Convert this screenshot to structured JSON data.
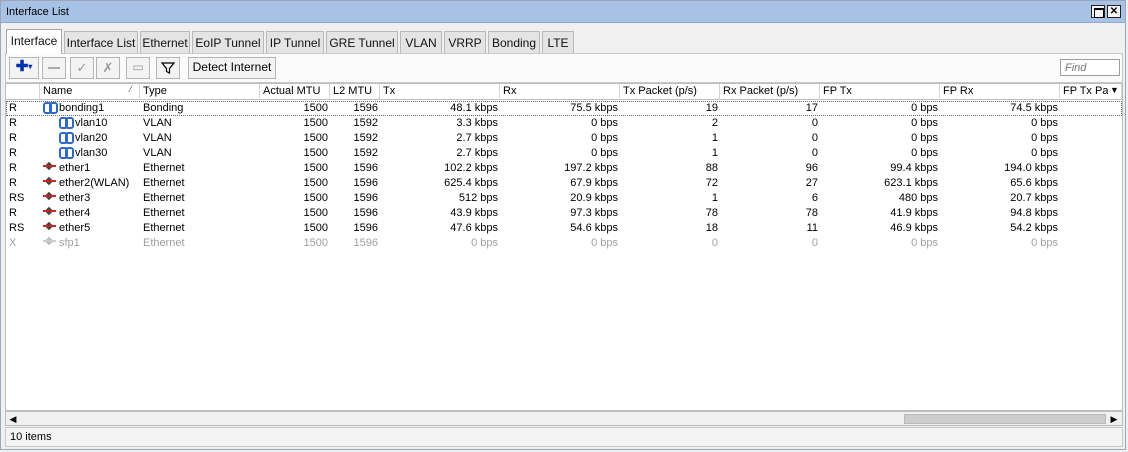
{
  "window": {
    "title": "Interface List"
  },
  "tabs": [
    {
      "label": "Interface",
      "active": true
    },
    {
      "label": "Interface List"
    },
    {
      "label": "Ethernet"
    },
    {
      "label": "EoIP Tunnel"
    },
    {
      "label": "IP Tunnel"
    },
    {
      "label": "GRE Tunnel"
    },
    {
      "label": "VLAN"
    },
    {
      "label": "VRRP"
    },
    {
      "label": "Bonding"
    },
    {
      "label": "LTE"
    }
  ],
  "toolbar": {
    "add_icon": "plus-icon",
    "remove_icon": "minus-icon",
    "enable_icon": "check-icon",
    "disable_icon": "x-icon",
    "comment_icon": "comment-icon",
    "filter_icon": "filter-icon",
    "detect_label": "Detect Internet",
    "find_placeholder": "Find"
  },
  "columns": [
    "",
    "Name",
    "Type",
    "Actual MTU",
    "L2 MTU",
    "Tx",
    "Rx",
    "Tx Packet (p/s)",
    "Rx Packet (p/s)",
    "FP Tx",
    "FP Rx",
    "FP Tx Pa"
  ],
  "rows": [
    {
      "flags": "R",
      "name": "bonding1",
      "icon": "bond-icon",
      "indent": false,
      "type": "Bonding",
      "mtu": "1500",
      "l2mtu": "1596",
      "tx": "48.1 kbps",
      "rx": "75.5 kbps",
      "txp": "19",
      "rxp": "17",
      "fptx": "0 bps",
      "fprx": "74.5 kbps"
    },
    {
      "flags": "R",
      "name": "vlan10",
      "icon": "bond-icon",
      "indent": true,
      "type": "VLAN",
      "mtu": "1500",
      "l2mtu": "1592",
      "tx": "3.3 kbps",
      "rx": "0 bps",
      "txp": "2",
      "rxp": "0",
      "fptx": "0 bps",
      "fprx": "0 bps"
    },
    {
      "flags": "R",
      "name": "vlan20",
      "icon": "bond-icon",
      "indent": true,
      "type": "VLAN",
      "mtu": "1500",
      "l2mtu": "1592",
      "tx": "2.7 kbps",
      "rx": "0 bps",
      "txp": "1",
      "rxp": "0",
      "fptx": "0 bps",
      "fprx": "0 bps"
    },
    {
      "flags": "R",
      "name": "vlan30",
      "icon": "bond-icon",
      "indent": true,
      "type": "VLAN",
      "mtu": "1500",
      "l2mtu": "1592",
      "tx": "2.7 kbps",
      "rx": "0 bps",
      "txp": "1",
      "rxp": "0",
      "fptx": "0 bps",
      "fprx": "0 bps"
    },
    {
      "flags": "R",
      "name": "ether1",
      "icon": "ethernet-icon",
      "indent": false,
      "type": "Ethernet",
      "mtu": "1500",
      "l2mtu": "1596",
      "tx": "102.2 kbps",
      "rx": "197.2 kbps",
      "txp": "88",
      "rxp": "96",
      "fptx": "99.4 kbps",
      "fprx": "194.0 kbps"
    },
    {
      "flags": "R",
      "name": "ether2(WLAN)",
      "icon": "ethernet-icon",
      "indent": false,
      "type": "Ethernet",
      "mtu": "1500",
      "l2mtu": "1596",
      "tx": "625.4 kbps",
      "rx": "67.9 kbps",
      "txp": "72",
      "rxp": "27",
      "fptx": "623.1 kbps",
      "fprx": "65.6 kbps"
    },
    {
      "flags": "RS",
      "name": "ether3",
      "icon": "ethernet-icon",
      "indent": false,
      "type": "Ethernet",
      "mtu": "1500",
      "l2mtu": "1596",
      "tx": "512 bps",
      "rx": "20.9 kbps",
      "txp": "1",
      "rxp": "6",
      "fptx": "480 bps",
      "fprx": "20.7 kbps"
    },
    {
      "flags": "R",
      "name": "ether4",
      "icon": "ethernet-icon",
      "indent": false,
      "type": "Ethernet",
      "mtu": "1500",
      "l2mtu": "1596",
      "tx": "43.9 kbps",
      "rx": "97.3 kbps",
      "txp": "78",
      "rxp": "78",
      "fptx": "41.9 kbps",
      "fprx": "94.8 kbps"
    },
    {
      "flags": "RS",
      "name": "ether5",
      "icon": "ethernet-icon",
      "indent": false,
      "type": "Ethernet",
      "mtu": "1500",
      "l2mtu": "1596",
      "tx": "47.6 kbps",
      "rx": "54.6 kbps",
      "txp": "18",
      "rxp": "11",
      "fptx": "46.9 kbps",
      "fprx": "54.2 kbps"
    },
    {
      "flags": "X",
      "name": "sfp1",
      "icon": "ethernet-icon",
      "indent": false,
      "type": "Ethernet",
      "mtu": "1500",
      "l2mtu": "1596",
      "tx": "0 bps",
      "rx": "0 bps",
      "txp": "0",
      "rxp": "0",
      "fptx": "0 bps",
      "fprx": "0 bps",
      "disabled": true
    }
  ],
  "status": {
    "count_text": "10 items"
  },
  "colors": {
    "titlebar": "#a7c2e4",
    "add_icon": "#0033aa",
    "bond_icon": "#2f69c7",
    "ethernet_icon": "#c22222"
  }
}
